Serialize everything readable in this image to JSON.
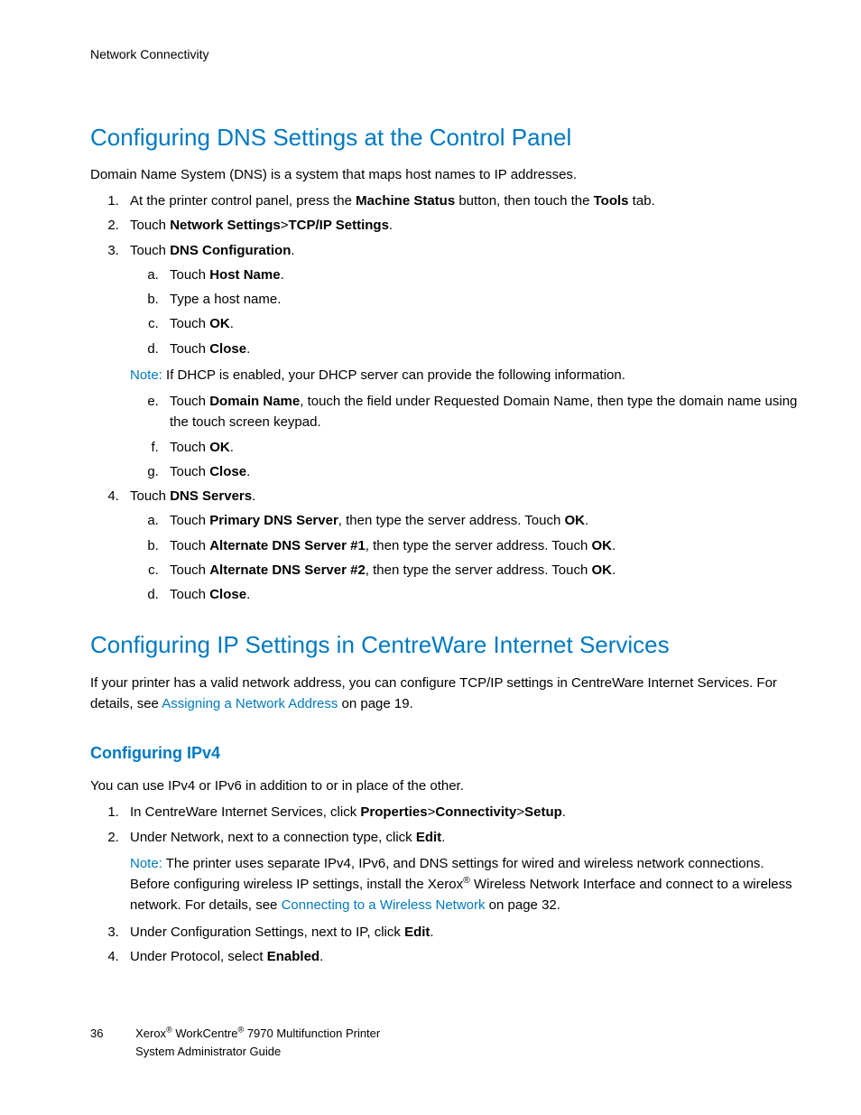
{
  "header": {
    "section": "Network Connectivity"
  },
  "h1": {
    "title": "Configuring DNS Settings at the Control Panel"
  },
  "p1": {
    "intro": "Domain Name System (DNS) is a system that maps host names to IP addresses."
  },
  "dns": {
    "s1a": "At the printer control panel, press the ",
    "s1b": "Machine Status",
    "s1c": " button, then touch the ",
    "s1d": "Tools",
    "s1e": " tab.",
    "s2a": "Touch ",
    "s2b": "Network Settings",
    "s2c": ">",
    "s2d": "TCP/IP Settings",
    "s2e": ".",
    "s3a": "Touch ",
    "s3b": "DNS Configuration",
    "s3c": ".",
    "s3_a_a": "Touch ",
    "s3_a_b": "Host Name",
    "s3_a_c": ".",
    "s3_b": "Type a host name.",
    "s3_c_a": "Touch ",
    "s3_c_b": "OK",
    "s3_c_c": ".",
    "s3_d_a": "Touch ",
    "s3_d_b": "Close",
    "s3_d_c": ".",
    "s3_note_prefix": "Note:",
    "s3_note_text": " If DHCP is enabled, your DHCP server can provide the following information.",
    "s3_e_a": "Touch ",
    "s3_e_b": "Domain Name",
    "s3_e_c": ", touch the field under Requested Domain Name, then type the domain name using the touch screen keypad.",
    "s3_f_a": "Touch ",
    "s3_f_b": "OK",
    "s3_f_c": ".",
    "s3_g_a": "Touch ",
    "s3_g_b": "Close",
    "s3_g_c": ".",
    "s4a": "Touch ",
    "s4b": "DNS Servers",
    "s4c": ".",
    "s4_a_a": "Touch ",
    "s4_a_b": "Primary DNS Server",
    "s4_a_c": ", then type the server address. Touch ",
    "s4_a_d": "OK",
    "s4_a_e": ".",
    "s4_b_a": "Touch ",
    "s4_b_b": "Alternate DNS Server #1",
    "s4_b_c": ", then type the server address. Touch ",
    "s4_b_d": "OK",
    "s4_b_e": ".",
    "s4_c_a": "Touch ",
    "s4_c_b": "Alternate DNS Server #2",
    "s4_c_c": ", then type the server address. Touch ",
    "s4_c_d": "OK",
    "s4_c_e": ".",
    "s4_d_a": "Touch ",
    "s4_d_b": "Close",
    "s4_d_c": "."
  },
  "h2": {
    "title": "Configuring IP Settings in CentreWare Internet Services"
  },
  "cw": {
    "p_a": "If your printer has a valid network address, you can configure TCP/IP settings in CentreWare Internet Services. For details, see ",
    "p_link": "Assigning a Network Address",
    "p_b": " on page 19."
  },
  "h3": {
    "title": "Configuring IPv4"
  },
  "ipv4": {
    "intro": "You can use IPv4 or IPv6 in addition to or in place of the other.",
    "s1a": "In CentreWare Internet Services, click ",
    "s1b": "Properties",
    "s1c": ">",
    "s1d": "Connectivity",
    "s1e": ">",
    "s1f": "Setup",
    "s1g": ".",
    "s2a": "Under Network, next to a connection type, click ",
    "s2b": "Edit",
    "s2c": ".",
    "note_prefix": "Note:",
    "note_a": " The printer uses separate IPv4, IPv6, and DNS settings for wired and wireless network connections. Before configuring wireless IP settings, install the Xerox",
    "note_reg": "®",
    "note_b": " Wireless Network Interface and connect to a wireless network. For details, see ",
    "note_link": "Connecting to a Wireless Network",
    "note_c": " on page 32.",
    "s3a": "Under Configuration Settings, next to IP, click ",
    "s3b": "Edit",
    "s3c": ".",
    "s4a": "Under Protocol, select ",
    "s4b": "Enabled",
    "s4c": "."
  },
  "footer": {
    "page": "36",
    "line1a": "Xerox",
    "reg": "®",
    "line1b": " WorkCentre",
    "line1c": " 7970 Multifunction Printer",
    "line2": "System Administrator Guide"
  }
}
